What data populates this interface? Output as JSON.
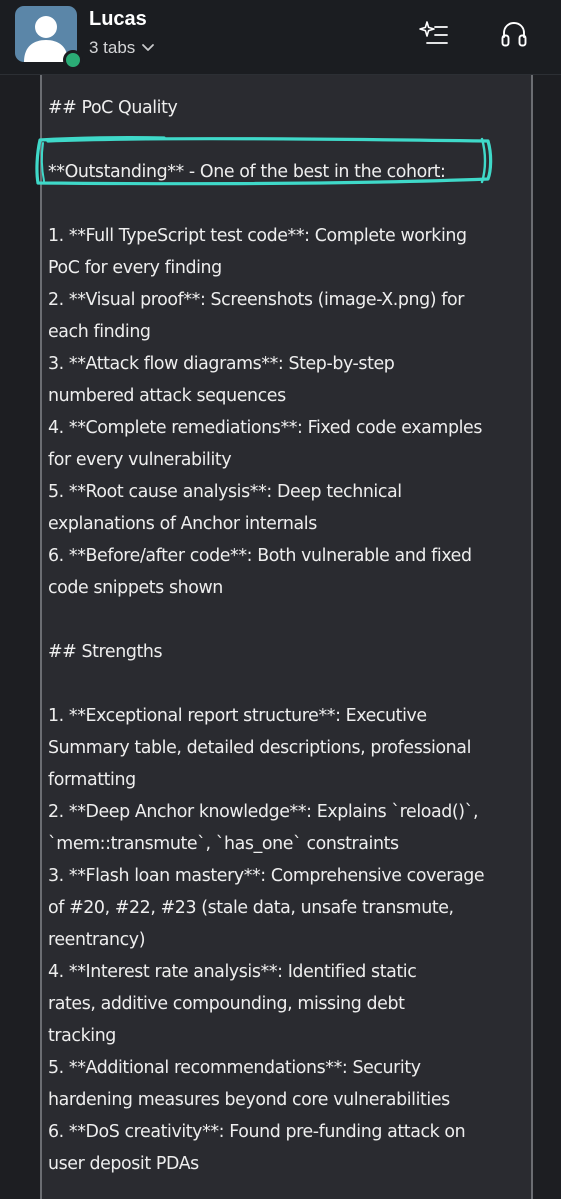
{
  "header": {
    "user_name": "Lucas",
    "tabs_label": "3 tabs",
    "icons": {
      "avatar": "person-icon",
      "tabs_chevron": "chevron-down-icon",
      "ai": "sparkle-list-icon",
      "huddle": "headphones-icon"
    },
    "colors": {
      "avatar_bg": "#5b86a8",
      "presence": "#2bac76"
    }
  },
  "document": {
    "highlight_color": "#3fd9c9",
    "lines": [
      "## PoC Quality",
      "",
      "**Outstanding** - One of the best in the cohort:",
      "",
      "1. **Full TypeScript test code**: Complete working",
      "PoC for every finding",
      "2. **Visual proof**: Screenshots (image-X.png) for",
      "each finding",
      "3. **Attack flow diagrams**: Step-by-step",
      "numbered attack sequences",
      "4. **Complete remediations**: Fixed code examples",
      "for every vulnerability",
      "5. **Root cause analysis**: Deep technical",
      "explanations of Anchor internals",
      "6. **Before/after code**: Both vulnerable and fixed",
      "code snippets shown",
      "",
      "## Strengths",
      "",
      "1. **Exceptional report structure**: Executive",
      "Summary table, detailed descriptions, professional",
      "formatting",
      "2. **Deep Anchor knowledge**: Explains `reload()`,",
      "`mem::transmute`, `has_one` constraints",
      "3. **Flash loan mastery**: Comprehensive coverage",
      "of #20, #22, #23 (stale data, unsafe transmute,",
      "reentrancy)",
      "4. **Interest rate analysis**: Identified static",
      "rates, additive compounding, missing debt",
      "tracking",
      "5. **Additional recommendations**: Security",
      "hardening measures beyond core vulnerabilities",
      "6. **DoS creativity**: Found pre-funding attack on",
      "user deposit PDAs"
    ]
  }
}
